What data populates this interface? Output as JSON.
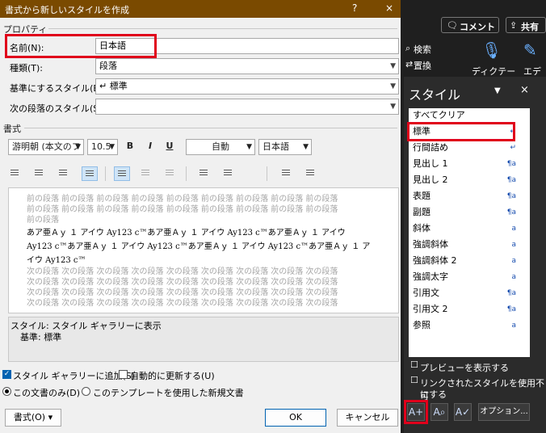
{
  "dialog": {
    "title": "書式から新しいスタイルを作成",
    "help": "?",
    "close": "×",
    "props_section": "プロパティ",
    "name_label": "名前(N):",
    "name_value": "日本語",
    "type_label": "種類(T):",
    "type_value": "段落",
    "base_label": "基準にするスタイル(B):",
    "base_value": "↵ 標準",
    "next_label": "次の段落のスタイル(S):",
    "next_value": "",
    "format_section": "書式",
    "font": "游明朝 (本文のフ",
    "size": "10.5",
    "bold": "B",
    "italic": "I",
    "underline": "U",
    "color": "自動",
    "lang": "日本語",
    "preview": {
      "prev_lines": [
        "前の段落 前の段落 前の段落 前の段落 前の段落 前の段落 前の段落 前の段落 前の段落",
        "前の段落 前の段落 前の段落 前の段落 前の段落 前の段落 前の段落 前の段落 前の段落",
        "前の段落"
      ],
      "sample_lines": [
        "あア亜Ａｙ １ アイウ Ay123 c™あア亜Ａｙ １ アイウ Ay123 c™あア亜Ａｙ １ アイウ",
        "Ay123 c™あア亜Ａｙ １ アイウ Ay123 c™あア亜Ａｙ １ アイウ Ay123 c™あア亜Ａｙ １ ア",
        "イウ Ay123 c™"
      ],
      "next_lines": [
        "次の段落 次の段落 次の段落 次の段落 次の段落 次の段落 次の段落 次の段落 次の段落",
        "次の段落 次の段落 次の段落 次の段落 次の段落 次の段落 次の段落 次の段落 次の段落",
        "次の段落 次の段落 次の段落 次の段落 次の段落 次の段落 次の段落 次の段落 次の段落",
        "次の段落 次の段落 次の段落 次の段落 次の段落 次の段落 次の段落 次の段落 次の段落"
      ]
    },
    "desc_line1": "スタイル: スタイル ギャラリーに表示",
    "desc_line2": "基準: 標準",
    "add_gallery": "スタイル ギャラリーに追加(S)",
    "auto_update": "自動的に更新する(U)",
    "this_doc": "この文書のみ(D)",
    "template_docs": "このテンプレートを使用した新規文書",
    "format_btn": "書式(O) ▾",
    "ok": "OK",
    "cancel": "キャンセル"
  },
  "word": {
    "comment": "コメント",
    "share": "共有",
    "search": "検索",
    "replace": "置換",
    "dictate": "ディクテー",
    "editor": "エディ"
  },
  "styles_pane": {
    "title": "スタイル",
    "clear_all": "すべてクリア",
    "items": [
      {
        "name": "標準",
        "mark": "↵"
      },
      {
        "name": "行間詰め",
        "mark": "↵"
      },
      {
        "name": "見出し 1",
        "mark": "¶a"
      },
      {
        "name": "見出し 2",
        "mark": "¶a"
      },
      {
        "name": "表題",
        "mark": "¶a"
      },
      {
        "name": "副題",
        "mark": "¶a"
      },
      {
        "name": "斜体",
        "mark": "a"
      },
      {
        "name": "強調斜体",
        "mark": "a"
      },
      {
        "name": "強調斜体 2",
        "mark": "a"
      },
      {
        "name": "強調太字",
        "mark": "a"
      },
      {
        "name": "引用文",
        "mark": "¶a"
      },
      {
        "name": "引用文 2",
        "mark": "¶a"
      },
      {
        "name": "参照",
        "mark": "a"
      }
    ],
    "show_preview": "プレビューを表示する",
    "disable_linked_1": "リンクされたスタイルを使用不可",
    "disable_linked_2": "にする",
    "options": "オプション..."
  }
}
